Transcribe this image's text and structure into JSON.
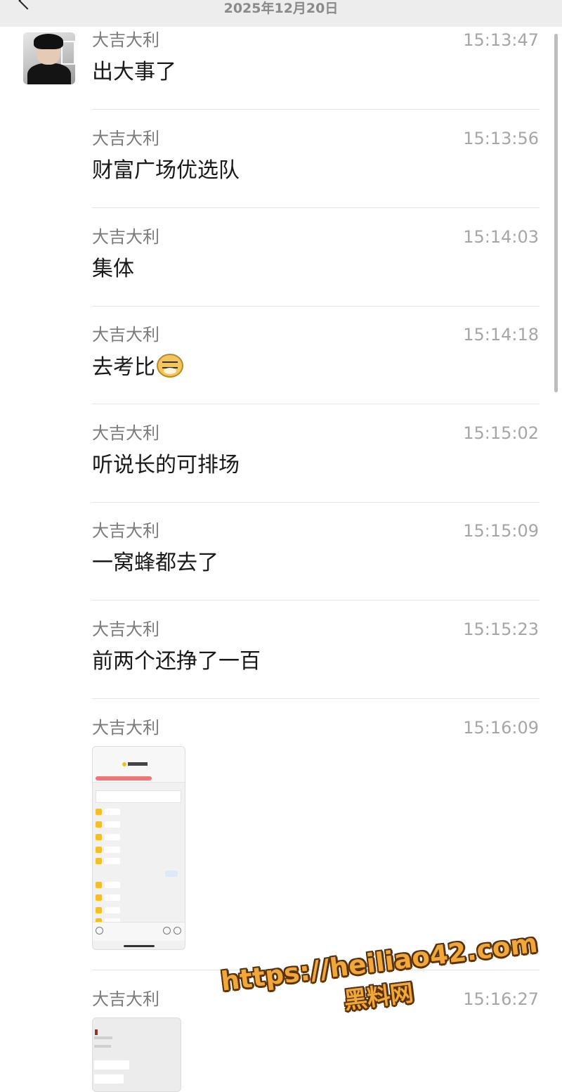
{
  "header": {
    "date": "2025年12月20日"
  },
  "messages": [
    {
      "sender": "大吉大利",
      "time": "15:13:47",
      "text": "出大事了"
    },
    {
      "sender": "大吉大利",
      "time": "15:13:56",
      "text": "财富广场优选队"
    },
    {
      "sender": "大吉大利",
      "time": "15:14:03",
      "text": "集体"
    },
    {
      "sender": "大吉大利",
      "time": "15:14:18",
      "text": "去考比",
      "emoji": "doge-emoji-icon"
    },
    {
      "sender": "大吉大利",
      "time": "15:15:02",
      "text": "听说长的可排场"
    },
    {
      "sender": "大吉大利",
      "time": "15:15:09",
      "text": "一窝蜂都去了"
    },
    {
      "sender": "大吉大利",
      "time": "15:15:23",
      "text": "前两个还挣了一百"
    },
    {
      "sender": "大吉大利",
      "time": "15:16:09",
      "type": "image"
    },
    {
      "sender": "大吉大利",
      "time": "15:16:27",
      "type": "image"
    }
  ],
  "watermark": {
    "url": "https://heiliao42.com",
    "label": "黑料网"
  },
  "colors": {
    "topbar_bg": "#ededed",
    "text": "#191919",
    "meta": "#7b7b7b",
    "watermark": "#f0a83a"
  }
}
